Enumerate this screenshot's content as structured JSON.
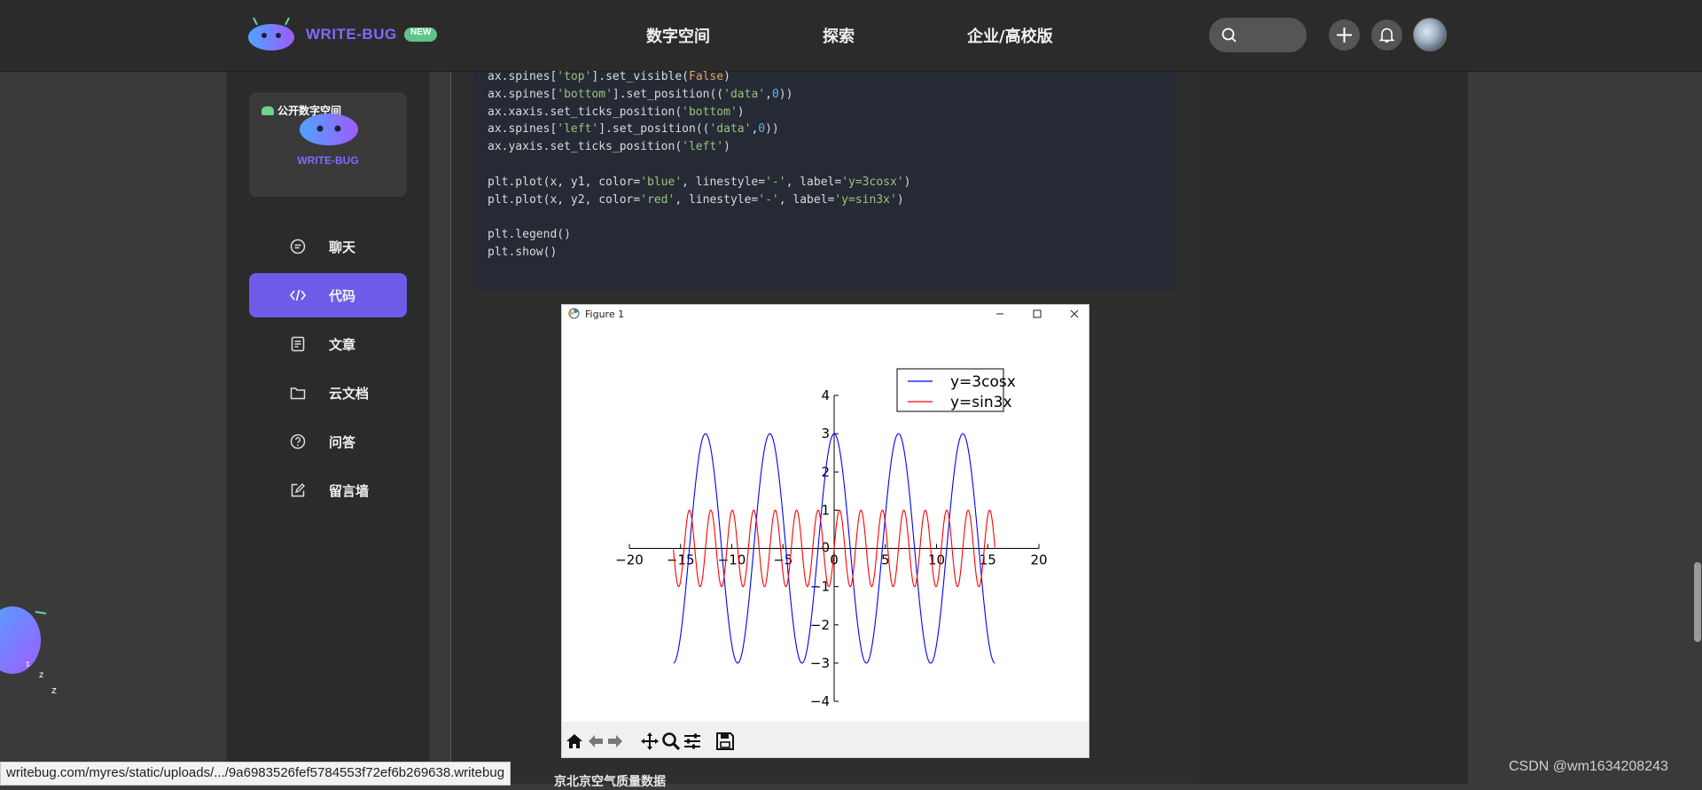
{
  "header": {
    "brand": "WRITE-BUG",
    "new_badge": "NEW",
    "nav": [
      "数字空间",
      "探索",
      "企业/高校版"
    ]
  },
  "sidebar": {
    "space_tag": "公开数字空间",
    "card_brand": "WRITE-BUG",
    "items": [
      {
        "label": "聊天",
        "icon": "chat-icon",
        "active": false
      },
      {
        "label": "代码",
        "icon": "code-icon",
        "active": true
      },
      {
        "label": "文章",
        "icon": "article-icon",
        "active": false
      },
      {
        "label": "云文档",
        "icon": "folder-icon",
        "active": false
      },
      {
        "label": "问答",
        "icon": "question-icon",
        "active": false
      },
      {
        "label": "留言墙",
        "icon": "edit-icon",
        "active": false
      }
    ]
  },
  "code": {
    "lines": [
      "ax.spines['top'].set_visible(False)",
      "ax.spines['bottom'].set_position(('data',0))",
      "ax.xaxis.set_ticks_position('bottom')",
      "ax.spines['left'].set_position(('data',0))",
      "ax.yaxis.set_ticks_position('left')",
      "",
      "plt.plot(x, y1, color='blue', linestyle='-', label='y=3cosx')",
      "plt.plot(x, y2, color='red', linestyle='-', label='y=sin3x')",
      "",
      "plt.legend()",
      "plt.show()"
    ]
  },
  "figure": {
    "window_title": "Figure 1",
    "toolbar": [
      "home-icon",
      "back-icon",
      "forward-icon",
      "pan-icon",
      "zoom-icon",
      "configure-icon",
      "save-icon"
    ]
  },
  "chart_data": {
    "type": "line",
    "xlim": [
      -20,
      20
    ],
    "ylim": [
      -4,
      4
    ],
    "xticks": [
      -20,
      -15,
      -10,
      -5,
      0,
      5,
      10,
      15,
      20
    ],
    "yticks": [
      -4,
      -3,
      -2,
      -1,
      0,
      1,
      2,
      3,
      4
    ],
    "xtick_labels": [
      "−20",
      "−15",
      "−10",
      "−5",
      "0",
      "5",
      "10",
      "15",
      "20"
    ],
    "ytick_labels": [
      "−4",
      "−3",
      "−2",
      "−1",
      "0",
      "1",
      "2",
      "3",
      "4"
    ],
    "x_range": [
      -15.7,
      15.7
    ],
    "series": [
      {
        "name": "y=3cosx",
        "color": "#0000ff",
        "amplitude": 3,
        "frequency": 1,
        "function": "cos"
      },
      {
        "name": "y=sin3x",
        "color": "#ff0000",
        "amplitude": 1,
        "frequency": 3,
        "function": "sin"
      }
    ],
    "legend_position": "top-right",
    "spines": "centered at origin"
  },
  "footer": {
    "status_url": "writebug.com/myres/static/uploads/.../9a6983526fef5784553f72ef6b269638.writebug",
    "next_heading": "京北京空气质量数据",
    "watermark": "CSDN @wm1634208243"
  }
}
